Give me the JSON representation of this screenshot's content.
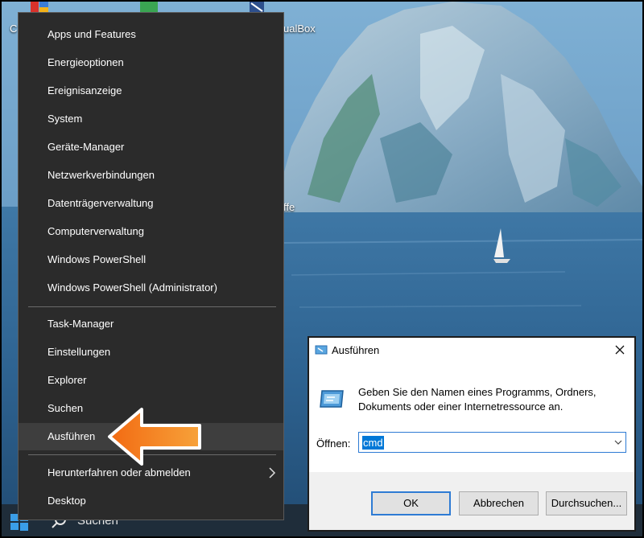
{
  "desktop": {
    "label_partial_c": "C",
    "label_virtualbox": "ualBox",
    "label_partial_ffe": "ffe"
  },
  "taskbar": {
    "search_text": "Suchen"
  },
  "context_menu": {
    "items": [
      {
        "label": "Apps und Features"
      },
      {
        "label": "Energieoptionen"
      },
      {
        "label": "Ereignisanzeige"
      },
      {
        "label": "System"
      },
      {
        "label": "Geräte-Manager"
      },
      {
        "label": "Netzwerkverbindungen"
      },
      {
        "label": "Datenträgerverwaltung"
      },
      {
        "label": "Computerverwaltung"
      },
      {
        "label": "Windows PowerShell"
      },
      {
        "label": "Windows PowerShell (Administrator)"
      },
      {
        "label": "Task-Manager"
      },
      {
        "label": "Einstellungen"
      },
      {
        "label": "Explorer"
      },
      {
        "label": "Suchen"
      },
      {
        "label": "Ausführen",
        "highlighted": true
      },
      {
        "label": "Herunterfahren oder abmelden",
        "has_submenu": true
      },
      {
        "label": "Desktop"
      }
    ]
  },
  "run_dialog": {
    "title": "Ausführen",
    "description": "Geben Sie den Namen eines Programms, Ordners, Dokuments oder einer Internetressource an.",
    "open_label": "Öffnen:",
    "input_value": "cmd",
    "buttons": {
      "ok": "OK",
      "cancel": "Abbrechen",
      "browse": "Durchsuchen..."
    }
  },
  "colors": {
    "menu_bg": "#2b2b2b",
    "menu_highlight": "#3e3e3e",
    "accent": "#0078d7",
    "arrow_orange": "#f07c1a"
  }
}
